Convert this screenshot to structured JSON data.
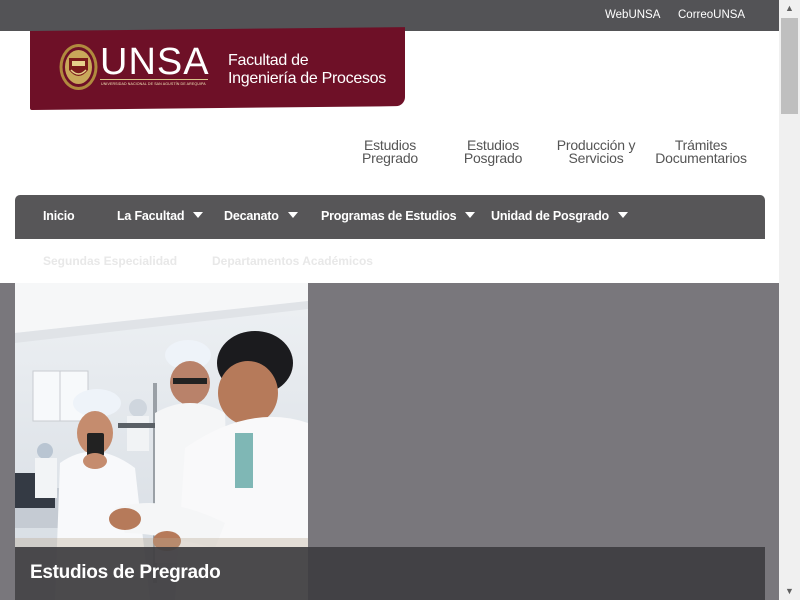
{
  "topbar": {
    "links": [
      "WebUNSA",
      "CorreoUNSA"
    ]
  },
  "brand": {
    "logo_text": "UNSA",
    "logo_subtitle": "UNIVERSIDAD NACIONAL DE SAN AGUSTÍN DE AREQUIPA",
    "faculty_line1": "Facultad de",
    "faculty_line2": "Ingeniería de Procesos",
    "banner_color": "#6e1027"
  },
  "quick_links": [
    {
      "line1": "Estudios",
      "line2": "Pregrado"
    },
    {
      "line1": "Estudios",
      "line2": "Posgrado"
    },
    {
      "line1": "Producción y",
      "line2": "Servicios"
    },
    {
      "line1": "Trámites",
      "line2": "Documentarios"
    }
  ],
  "nav": {
    "items": [
      {
        "label": "Inicio",
        "dropdown": false
      },
      {
        "label": "La Facultad",
        "dropdown": true
      },
      {
        "label": "Decanato",
        "dropdown": true
      },
      {
        "label": "Programas de Estudios",
        "dropdown": true
      },
      {
        "label": "Unidad de Posgrado",
        "dropdown": true
      }
    ],
    "row2": [
      "Segundas Especialidad",
      "Departamentos Académicos"
    ]
  },
  "hero": {
    "caption": "Estudios de Pregrado",
    "image": "students-in-laboratory-photo"
  },
  "icons": {
    "dropdown": "caret-down-icon",
    "scroll_up": "arrow-up-icon",
    "scroll_down": "arrow-down-icon"
  }
}
